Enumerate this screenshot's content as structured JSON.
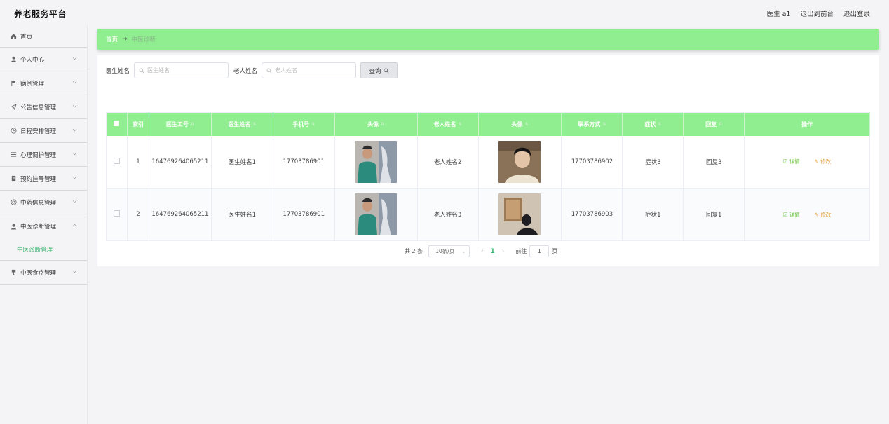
{
  "app": {
    "title": "养老服务平台"
  },
  "header": {
    "user": "医生 a1",
    "to_front": "退出到前台",
    "logout": "退出登录"
  },
  "sidebar": {
    "items": [
      {
        "label": "首页",
        "icon": "home-icon"
      },
      {
        "label": "个人中心",
        "icon": "user-icon"
      },
      {
        "label": "病例管理",
        "icon": "flag-icon"
      },
      {
        "label": "公告信息管理",
        "icon": "send-icon"
      },
      {
        "label": "日程安排管理",
        "icon": "clock-icon"
      },
      {
        "label": "心理调护管理",
        "icon": "list-icon"
      },
      {
        "label": "预约挂号管理",
        "icon": "file-icon"
      },
      {
        "label": "中药信息管理",
        "icon": "target-icon"
      },
      {
        "label": "中医诊断管理",
        "icon": "user-icon"
      },
      {
        "label": "中医食疗管理",
        "icon": "cup-icon"
      }
    ],
    "active_sub": "中医诊断管理"
  },
  "breadcrumb": {
    "home": "首页",
    "current": "中医诊断"
  },
  "search": {
    "doctor_label": "医生姓名",
    "doctor_placeholder": "医生姓名",
    "elder_label": "老人姓名",
    "elder_placeholder": "老人姓名",
    "query_label": "查询"
  },
  "table": {
    "headers": [
      "索引",
      "医生工号",
      "医生姓名",
      "手机号",
      "头像",
      "老人姓名",
      "头像",
      "联系方式",
      "症状",
      "回复",
      "操作"
    ],
    "rows": [
      {
        "index": "1",
        "doctor_no": "164769264065211",
        "doctor_name": "医生姓名1",
        "phone": "17703786901",
        "elder_name": "老人姓名2",
        "contact": "17703786902",
        "symptom": "症状3",
        "reply": "回复3"
      },
      {
        "index": "2",
        "doctor_no": "164769264065211",
        "doctor_name": "医生姓名1",
        "phone": "17703786901",
        "elder_name": "老人姓名3",
        "contact": "17703786903",
        "symptom": "症状1",
        "reply": "回复1"
      }
    ],
    "action_detail": "详情",
    "action_edit": "修改"
  },
  "pagination": {
    "total": "共 2 条",
    "page_size": "10条/页",
    "current_page": "1",
    "goto_label": "前往",
    "goto_value": "1",
    "page_suffix": "页"
  },
  "colors": {
    "accent": "#90ee90",
    "active": "#3cb371",
    "detail": "#67c23a",
    "edit": "#e6a23c"
  }
}
